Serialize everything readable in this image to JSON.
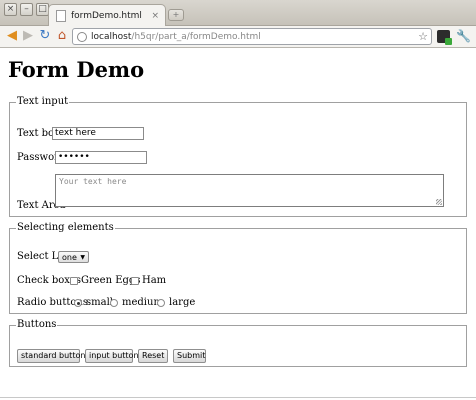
{
  "browser": {
    "window_buttons": [
      "×",
      "–",
      "□"
    ],
    "tab_title": "formDemo.html",
    "tab_close": "×",
    "new_tab": "+",
    "url_host": "localhost",
    "url_path": "/h5qr/part_a/formDemo.html",
    "icons": {
      "back": "back-arrow-icon",
      "forward": "forward-arrow-icon",
      "reload": "reload-icon",
      "home": "home-icon",
      "page": "page-icon",
      "bookmark": "star-icon",
      "extension": "extension-icon",
      "menu": "wrench-icon"
    }
  },
  "page": {
    "title": "Form Demo",
    "text_input": {
      "legend": "Text input",
      "textbox_label": "Text box",
      "textbox_value": "text here",
      "password_label": "Password",
      "password_value": "••••••",
      "textarea_label": "Text Area",
      "textarea_placeholder": "Your text here"
    },
    "selecting": {
      "legend": "Selecting elements",
      "select_label": "Select List",
      "select_value": "one",
      "checkboxes_label": "Check boxes",
      "checkboxes": [
        "Green Eggs",
        "Ham"
      ],
      "radio_label": "Radio buttons",
      "radios": [
        "small",
        "medium",
        "large"
      ],
      "radio_selected": "small"
    },
    "buttons": {
      "legend": "Buttons",
      "items": [
        "standard button",
        "input button",
        "Reset",
        "Submit"
      ]
    }
  }
}
